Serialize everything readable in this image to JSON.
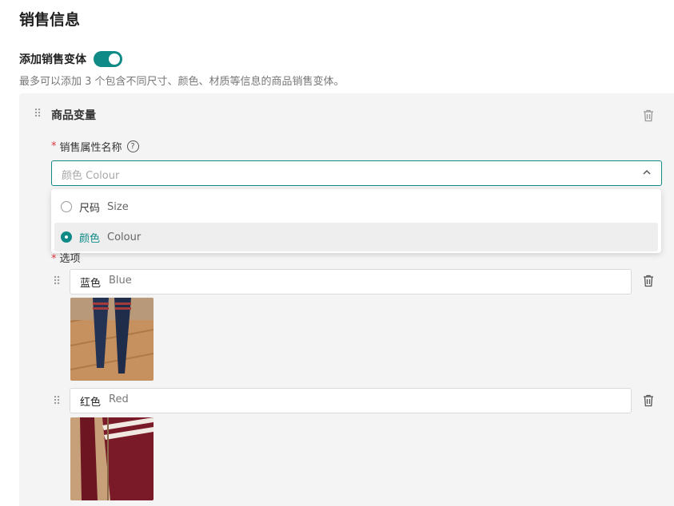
{
  "page": {
    "title": "销售信息",
    "variant_toggle_label": "添加销售变体",
    "variant_toggle_on": true,
    "hint": "最多可以添加 3 个包含不同尺寸、颜色、材质等信息的商品销售变体。"
  },
  "panel": {
    "title": "商品变量",
    "attr_label": "销售属性名称",
    "required_mark": "*",
    "help_icon": "?",
    "select_value": "颜色 Colour",
    "dropdown_options": [
      {
        "cn": "尺码",
        "en": "Size",
        "selected": false
      },
      {
        "cn": "颜色",
        "en": "Colour",
        "selected": true
      }
    ],
    "options_label": "选项",
    "values": [
      {
        "cn": "蓝色",
        "en": "Blue",
        "image": "navy-socks-photo"
      },
      {
        "cn": "红色",
        "en": "Red",
        "image": "red-socks-photo"
      }
    ]
  },
  "colors": {
    "accent": "#0f8a87",
    "required": "#d9363e"
  }
}
